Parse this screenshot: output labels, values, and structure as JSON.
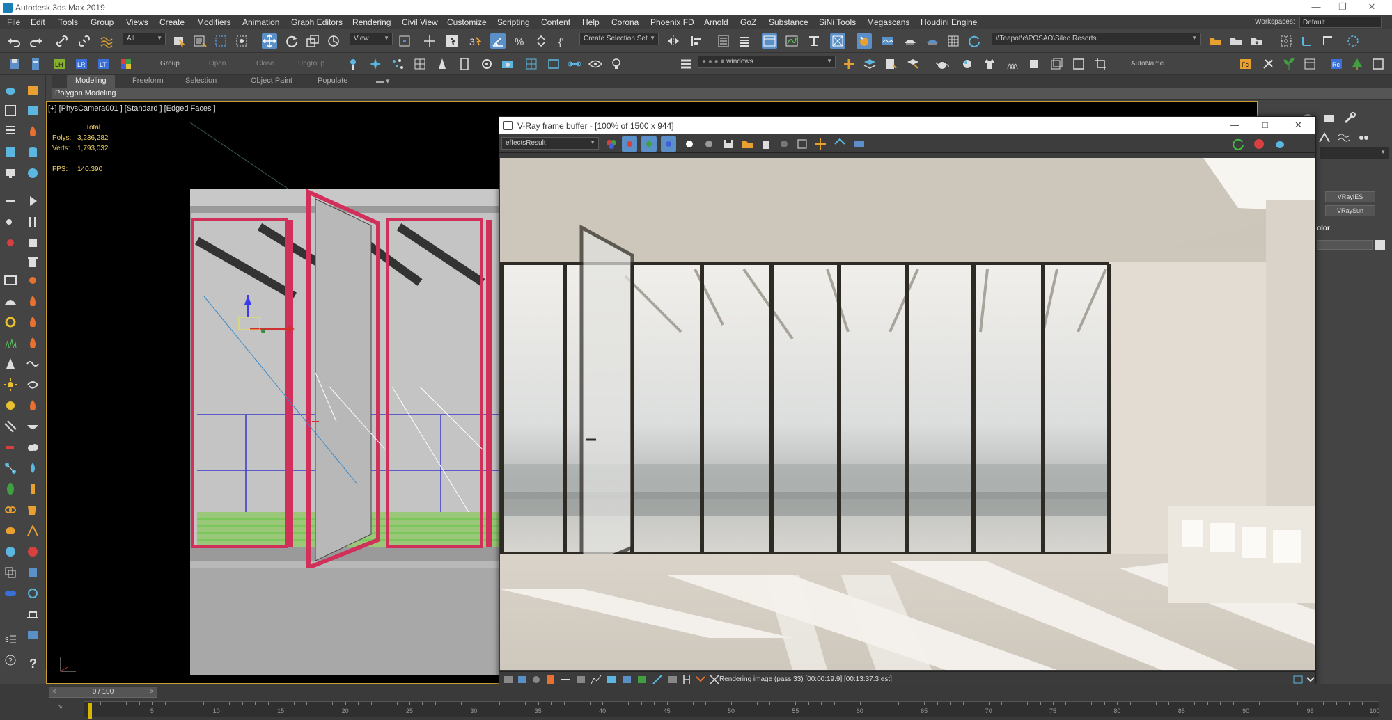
{
  "window": {
    "title": "Autodesk 3ds Max 2019"
  },
  "menu": [
    "File",
    "Edit",
    "Tools",
    "Group",
    "Views",
    "Create",
    "Modifiers",
    "Animation",
    "Graph Editors",
    "Rendering",
    "Civil View",
    "Customize",
    "Scripting",
    "Content",
    "Help",
    "Corona",
    "Phoenix FD",
    "Arnold",
    "GoZ",
    "Substance",
    "SiNi Tools",
    "Megascans",
    "Houdini Engine"
  ],
  "workspaces": {
    "label": "Workspaces:",
    "value": "Default"
  },
  "toolbar1": {
    "filter": "All",
    "coord_system": "View",
    "selection_set": "Create Selection Set",
    "path": "\\\\Teapot\\e\\POSAO\\Sileo Resorts"
  },
  "toolbar2": {
    "labels": [
      "Group",
      "Open",
      "Close",
      "Ungroup"
    ],
    "layer": "windows",
    "autoname": "AutoName"
  },
  "ribbon": {
    "tabs": [
      "Modeling",
      "Freeform",
      "Selection",
      "Object Paint",
      "Populate"
    ],
    "active_tab": "Modeling",
    "panel": "Polygon Modeling"
  },
  "viewport": {
    "label": "[+] [PhysCamera001 ] [Standard ] [Edged Faces ]",
    "stats_header": "Total",
    "polys_label": "Polys:",
    "polys": "3,236,282",
    "verts_label": "Verts:",
    "verts": "1,793,032",
    "fps_label": "FPS:",
    "fps": "140.390"
  },
  "vfb": {
    "title": "V-Ray frame buffer - [100% of 1500 x 944]",
    "channel": "effectsResult",
    "status": "Rendering image (pass 33) [00:00:19.9] [00:13:37.3 est]"
  },
  "right_panel": {
    "buttons": [
      "VRayIES",
      "VRaySun"
    ],
    "label": "olor"
  },
  "timeline": {
    "frame": "0 / 100",
    "ticks": [
      "5",
      "10",
      "15",
      "20",
      "25",
      "30",
      "35",
      "40",
      "45",
      "50",
      "55",
      "60",
      "65",
      "70",
      "75",
      "80",
      "85",
      "90",
      "95",
      "100"
    ]
  },
  "colors": {
    "accent": "#5b8fc7",
    "selection": "#d0305a",
    "frame_border": "#c8a032",
    "stats": "#f0d060"
  }
}
